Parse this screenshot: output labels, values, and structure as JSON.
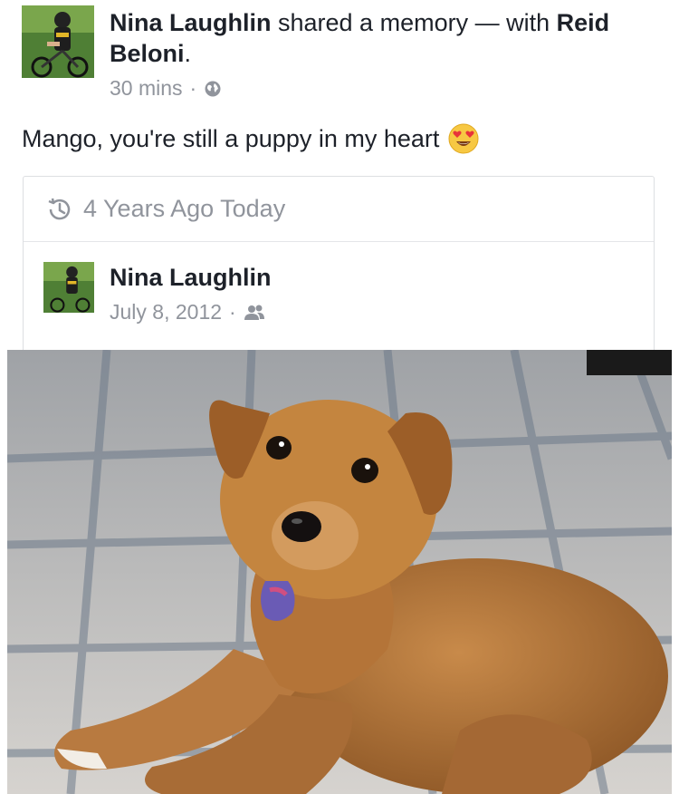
{
  "post": {
    "author": "Nina Laughlin",
    "action": " shared a memory — with ",
    "tagged": "Reid Beloni",
    "punct": ".",
    "time": "30 mins",
    "separator": "·",
    "privacy_icon": "globe-icon",
    "caption": "Mango, you're still a puppy in my heart",
    "caption_emoji": "heart-eyes-emoji"
  },
  "memory": {
    "title": "4 Years Ago Today",
    "title_icon": "history-icon",
    "original": {
      "author": "Nina Laughlin",
      "date": "July 8, 2012",
      "separator": "·",
      "privacy_icon": "friends-icon"
    }
  },
  "photo": {
    "subject": "puppy-photo"
  },
  "colors": {
    "text": "#1d2129",
    "secondary": "#90949c",
    "border": "#dddfe2"
  }
}
